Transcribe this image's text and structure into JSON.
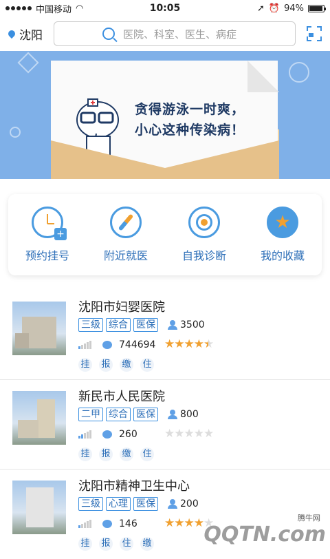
{
  "status_bar": {
    "carrier": "中国移动",
    "time": "10:05",
    "battery": "94%",
    "battery_level": 0.94
  },
  "search": {
    "city": "沈阳",
    "placeholder": "医院、科室、医生、病症"
  },
  "banner": {
    "line1": "贪得游泳一时爽，",
    "line2": "小心这种传染病！"
  },
  "quick_menu": [
    {
      "label": "预约挂号",
      "icon": "clock-plus-icon"
    },
    {
      "label": "附近就医",
      "icon": "compass-icon"
    },
    {
      "label": "自我诊断",
      "icon": "target-icon"
    },
    {
      "label": "我的收藏",
      "icon": "star-icon"
    }
  ],
  "hospitals": [
    {
      "name": "沈阳市妇婴医院",
      "tags": [
        "三级",
        "综合",
        "医保"
      ],
      "doctors": "3500",
      "visits": "744694",
      "rating": 4.5,
      "services": [
        "挂",
        "报",
        "缴",
        "住"
      ]
    },
    {
      "name": "新民市人民医院",
      "tags": [
        "二甲",
        "综合",
        "医保"
      ],
      "doctors": "800",
      "visits": "260",
      "rating": 0,
      "services": [
        "挂",
        "报",
        "缴",
        "住"
      ]
    },
    {
      "name": "沈阳市精神卫生中心",
      "tags": [
        "三级",
        "心理",
        "医保"
      ],
      "doctors": "200",
      "visits": "146",
      "rating": 4,
      "services": [
        "挂",
        "报",
        "住",
        "缴"
      ]
    }
  ],
  "watermark": {
    "brand": "QQTN.com",
    "sub": "腾牛网"
  },
  "colors": {
    "accent": "#3b8fe0",
    "star": "#f0a030",
    "banner": "#7fb0e8"
  }
}
